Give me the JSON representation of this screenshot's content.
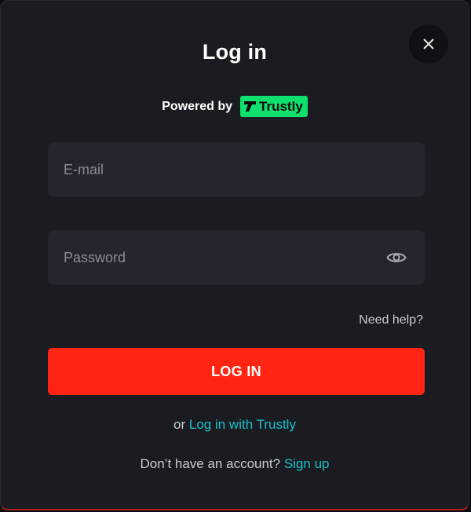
{
  "dialog": {
    "title": "Log in",
    "powered_by": "Powered by",
    "provider": "Trustly",
    "close_icon": "close-icon"
  },
  "form": {
    "email": {
      "value": "",
      "placeholder": "E-mail"
    },
    "password": {
      "value": "",
      "placeholder": "Password",
      "toggle_icon": "eye-icon"
    },
    "need_help": "Need help?",
    "submit_label": "LOG IN"
  },
  "alt": {
    "or": "or",
    "trustly_link": "Log in with Trustly"
  },
  "signup": {
    "prompt": "Don’t have an account?",
    "link": "Sign up"
  },
  "colors": {
    "background": "#1b1c21",
    "field": "#25262d",
    "primary": "#ff2512",
    "link": "#19c0c9",
    "trustly": "#0ee06e"
  }
}
